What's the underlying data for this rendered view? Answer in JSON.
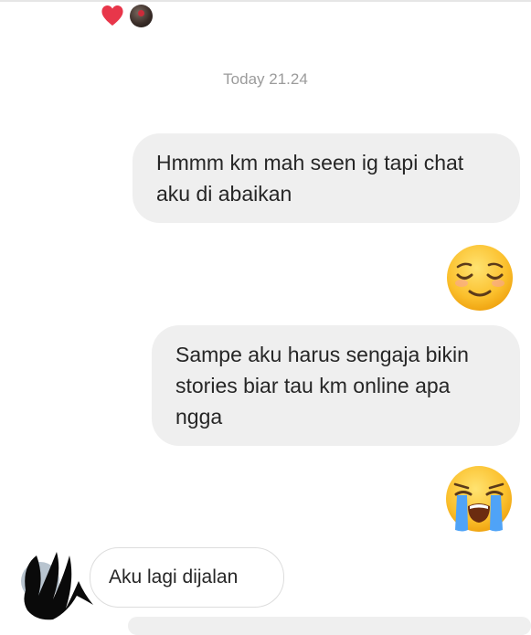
{
  "reaction": {
    "icon": "heart-icon",
    "color": "#e8364a"
  },
  "timestamp": "Today 21.24",
  "messages_sent": [
    {
      "text": "Hmmm km mah seen ig tapi chat\naku di abaikan"
    },
    {
      "emoji": "relieved-face-icon"
    },
    {
      "text": "Sampe aku harus sengaja bikin\nstories biar tau km online apa\nngga"
    },
    {
      "emoji": "loudly-crying-face-icon"
    }
  ],
  "messages_received": [
    {
      "text": "Aku lagi dijalan"
    }
  ],
  "colors": {
    "sent_bubble": "#efefef",
    "received_bubble_border": "#dddddd",
    "text": "#262626",
    "timestamp": "#9b9b9b"
  }
}
